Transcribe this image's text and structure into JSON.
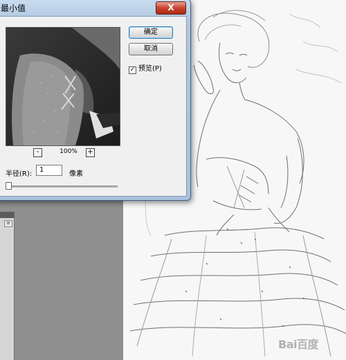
{
  "dialog": {
    "title": "最小值",
    "close_label": "X",
    "ok_label": "确定",
    "cancel_label": "取消",
    "preview_label": "预览(P)",
    "preview_checked": true,
    "zoom_minus": "-",
    "zoom_plus": "+",
    "zoom_value": "100%",
    "radius_label": "半径(R):",
    "radius_value": "1",
    "radius_unit": "像素",
    "radius_slider_fraction": 0.02
  },
  "left_panel": {
    "menu_icon": "panel-menu-icon"
  },
  "watermark": {
    "text": "Bai百度"
  },
  "colors": {
    "dialog_frame": "#b2c9e2",
    "close_button": "#c8452f",
    "workspace": "#8f8f8f",
    "canvas": "#f7f7f7"
  }
}
